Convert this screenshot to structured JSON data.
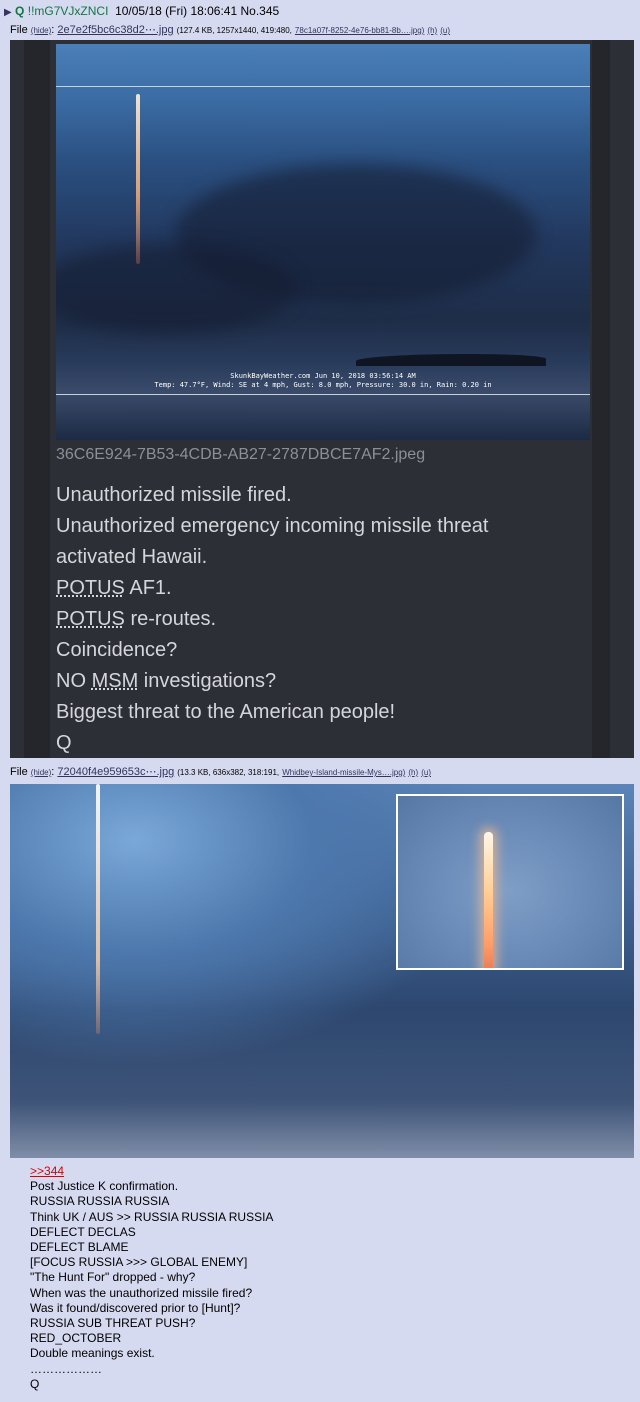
{
  "post": {
    "name": "Q",
    "trip": "!!mG7VJxZNCI",
    "datetime": "10/05/18 (Fri) 18:06:41",
    "number": "No.345"
  },
  "file1": {
    "label": "File",
    "hide": "(hide)",
    "name": "2e7e2f5bc6c38d2⋯.jpg",
    "meta": "(127.4 KB, 1257x1440, 419:480,",
    "orig": "78c1a07f-8252-4e76-bb81-8b….jpg)",
    "h": "(h)",
    "u": "(u)",
    "ticker1": "SkunkBayWeather.com  Jun 10, 2018  03:56:14 AM",
    "ticker2": "Temp:  47.7°F, Wind: SE  at   4 mph, Gust:  8.0 mph, Pressure:  30.0 in, Rain: 0.20 in",
    "caption": "36C6E924-7B53-4CDB-AB27-2787DBCE7AF2.jpeg",
    "lines": [
      "Unauthorized missile fired.",
      "Unauthorized emergency incoming missile threat",
      "activated Hawaii.",
      "POTUS",
      " AF1.",
      "POTUS",
      " re-routes.",
      "Coincidence?",
      "NO ",
      "MSM",
      " investigations?",
      "Biggest threat to the American people!",
      "Q"
    ]
  },
  "file2": {
    "label": "File",
    "hide": "(hide)",
    "name": "72040f4e959653c⋯.jpg",
    "meta": "(13.3 KB, 636x382, 318:191,",
    "orig": "Whidbey-Island-missile-Mys….jpg)",
    "h": "(h)",
    "u": "(u)"
  },
  "body": {
    "quotelink": ">>344",
    "lines": [
      "Post Justice K confirmation.",
      "RUSSIA RUSSIA RUSSIA",
      "Think UK / AUS >> RUSSIA RUSSIA RUSSIA",
      "DEFLECT DECLAS",
      "DEFLECT BLAME",
      "[FOCUS RUSSIA >>> GLOBAL ENEMY]",
      "\"The Hunt For\" dropped - why?",
      "When was the unauthorized missile fired?",
      "Was it found/discovered prior to [Hunt]?",
      "RUSSIA SUB THREAT PUSH?",
      "RED_OCTOBER",
      "Double meanings exist.",
      "………………",
      "Q"
    ]
  }
}
